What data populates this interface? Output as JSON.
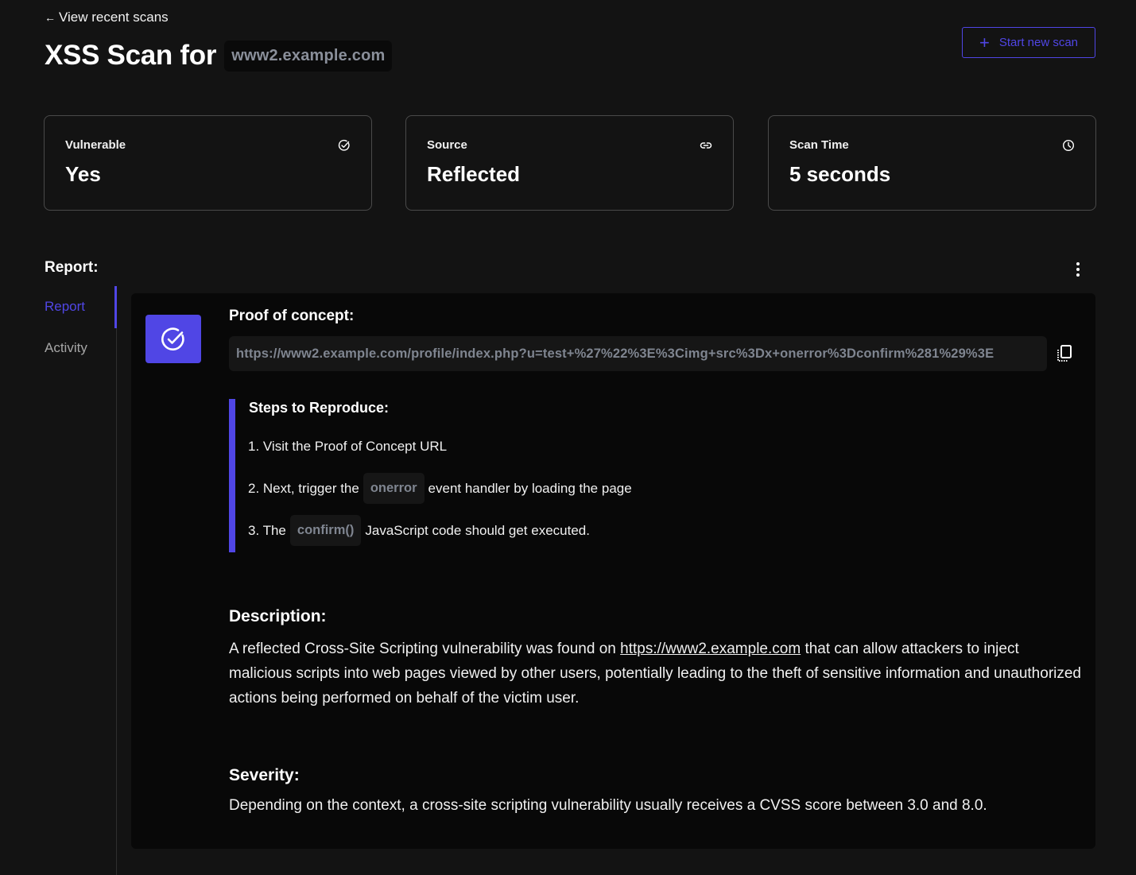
{
  "header": {
    "back_link": "View recent scans",
    "title": "XSS Scan for",
    "domain": "www2.example.com",
    "new_scan_label": "Start new scan"
  },
  "stats": [
    {
      "label": "Vulnerable",
      "value": "Yes",
      "icon": "check-circle-icon"
    },
    {
      "label": "Source",
      "value": "Reflected",
      "icon": "link-icon"
    },
    {
      "label": "Scan Time",
      "value": "5 seconds",
      "icon": "clock-icon"
    }
  ],
  "report": {
    "heading": "Report:",
    "nav": [
      {
        "label": "Report",
        "active": true
      },
      {
        "label": "Activity",
        "active": false
      }
    ],
    "poc_heading": "Proof of concept:",
    "poc_url": "https://www2.example.com/profile/index.php?u=test+%27%22%3E%3Cimg+src%3Dx+onerror%3Dconfirm%281%29%3E",
    "steps_heading": "Steps to Reproduce:",
    "steps": [
      {
        "before": "1. Visit the Proof of Concept URL",
        "code": "",
        "after": ""
      },
      {
        "before": "2. Next, trigger the",
        "code": "onerror",
        "after": "event handler by loading the page"
      },
      {
        "before": "3. The",
        "code": "confirm()",
        "after": "JavaScript code should get executed."
      }
    ],
    "description_heading": "Description:",
    "description_before": "A reflected Cross-Site Scripting vulnerability was found on ",
    "description_link": "https://www2.example.com",
    "description_after": " that can allow attackers to inject malicious scripts into web pages viewed by other users, potentially leading to the theft of sensitive information and unauthorized actions being performed on behalf of the victim user.",
    "severity_heading": "Severity:",
    "severity_text": "Depending on the context, a cross-site scripting vulnerability usually receives a CVSS score between 3.0 and 8.0."
  },
  "colors": {
    "accent": "#5046e5",
    "background": "#131313",
    "panel": "#080808"
  }
}
